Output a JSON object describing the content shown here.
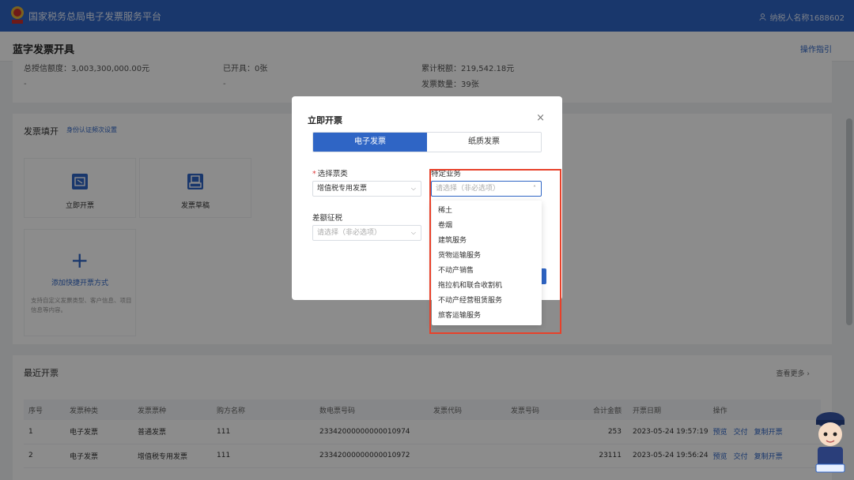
{
  "topbar": {
    "title": "国家税务总局电子发票服务平台",
    "user": "纳税人名称1688602"
  },
  "page": {
    "title": "蓝字发票开具",
    "guide": "操作指引"
  },
  "stats": {
    "credit_label": "总授信额度：",
    "credit_value": "3,003,300,000.00元",
    "issued_label": "已开具：",
    "issued_value": "0张",
    "tax_label": "累计税额：",
    "tax_value": "219,542.18元",
    "count_label": "发票数量：",
    "count_value": "39张",
    "dash": "-"
  },
  "fill_section": {
    "title": "发票填开",
    "link": "身份认证频次设置",
    "tiles": [
      "立即开票",
      "发票草稿"
    ],
    "add_label": "添加快捷开票方式",
    "add_desc": "支持自定义发票类型、客户信息、项目信息等内容。"
  },
  "recent": {
    "title": "最近开票",
    "more": "查看更多",
    "headers": [
      "序号",
      "发票种类",
      "发票票种",
      "购方名称",
      "数电票号码",
      "发票代码",
      "发票号码",
      "合计金额",
      "开票日期",
      "操作"
    ],
    "rows": [
      {
        "no": "1",
        "kind": "电子发票",
        "type": "普通发票",
        "buyer": "111",
        "number": "23342000000000010974",
        "code": "",
        "invno": "",
        "amount": "253",
        "date": "2023-05-24 19:57:19"
      },
      {
        "no": "2",
        "kind": "电子发票",
        "type": "增值税专用发票",
        "buyer": "111",
        "number": "23342000000000010972",
        "code": "",
        "invno": "",
        "amount": "23111",
        "date": "2023-05-24 19:56:24"
      }
    ],
    "ops": [
      "预览",
      "交付",
      "复制开票"
    ]
  },
  "dialog": {
    "title": "立即开票",
    "close": "×",
    "tab_electronic": "电子发票",
    "tab_paper": "纸质发票",
    "invoice_type_label": "选择票类",
    "invoice_type_value": "增值税专用发票",
    "special_label": "特定业务",
    "special_placeholder": "请选择（非必选项）",
    "diff_label": "差额征税",
    "diff_placeholder": "请选择（非必选项）"
  },
  "dropdown_options": [
    "稀土",
    "卷烟",
    "建筑服务",
    "货物运输服务",
    "不动产销售",
    "拖拉机和联合收割机",
    "不动产经营租赁服务",
    "旅客运输服务"
  ],
  "colors": {
    "brand": "#2f65c5",
    "highlight": "#e8412a"
  }
}
